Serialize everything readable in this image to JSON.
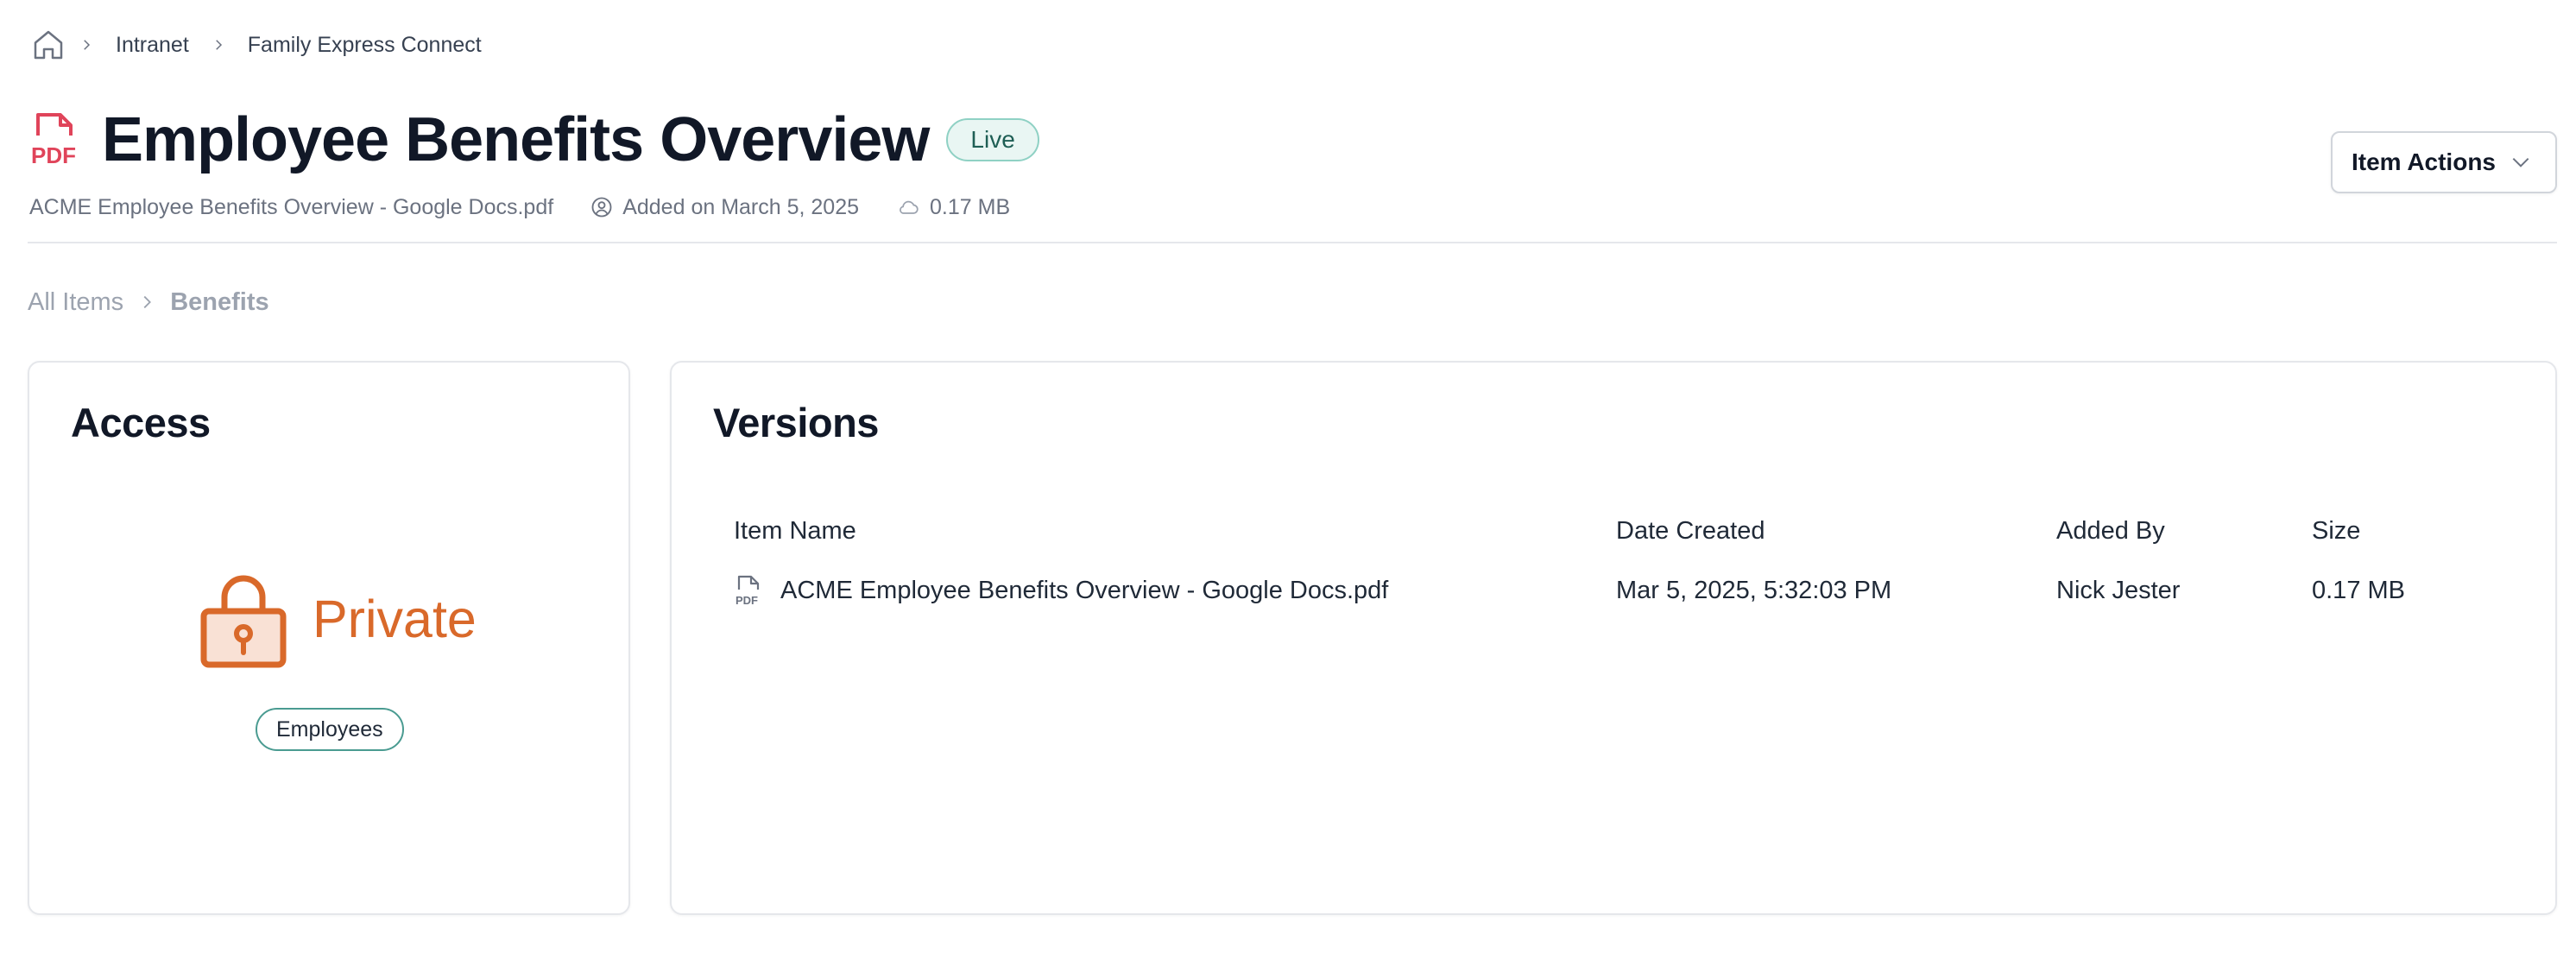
{
  "breadcrumb": {
    "items": [
      "Intranet",
      "Family Express Connect"
    ]
  },
  "header": {
    "title": "Employee Benefits Overview",
    "status": "Live",
    "actions_label": "Item Actions"
  },
  "meta": {
    "filename": "ACME Employee Benefits Overview - Google Docs.pdf",
    "added": "Added on March 5, 2025",
    "size": "0.17 MB"
  },
  "sub_breadcrumb": {
    "root": "All Items",
    "current": "Benefits"
  },
  "access": {
    "title": "Access",
    "level": "Private",
    "groups": [
      "Employees"
    ]
  },
  "versions": {
    "title": "Versions",
    "columns": [
      "Item Name",
      "Date Created",
      "Added By",
      "Size"
    ],
    "rows": [
      {
        "name": "ACME Employee Benefits Overview - Google Docs.pdf",
        "date": "Mar 5, 2025, 5:32:03 PM",
        "added_by": "Nick Jester",
        "size": "0.17 MB"
      }
    ]
  },
  "colors": {
    "pdf_red": "#e0445a",
    "private_orange": "#d9692a",
    "live_green": "#1f5f55",
    "pill_teal": "#4a9b91"
  },
  "icons": [
    "home-icon",
    "chevron-right-icon",
    "pdf-file-icon",
    "chevron-down-icon",
    "user-circle-icon",
    "cloud-icon",
    "lock-icon",
    "pdf-small-icon"
  ]
}
